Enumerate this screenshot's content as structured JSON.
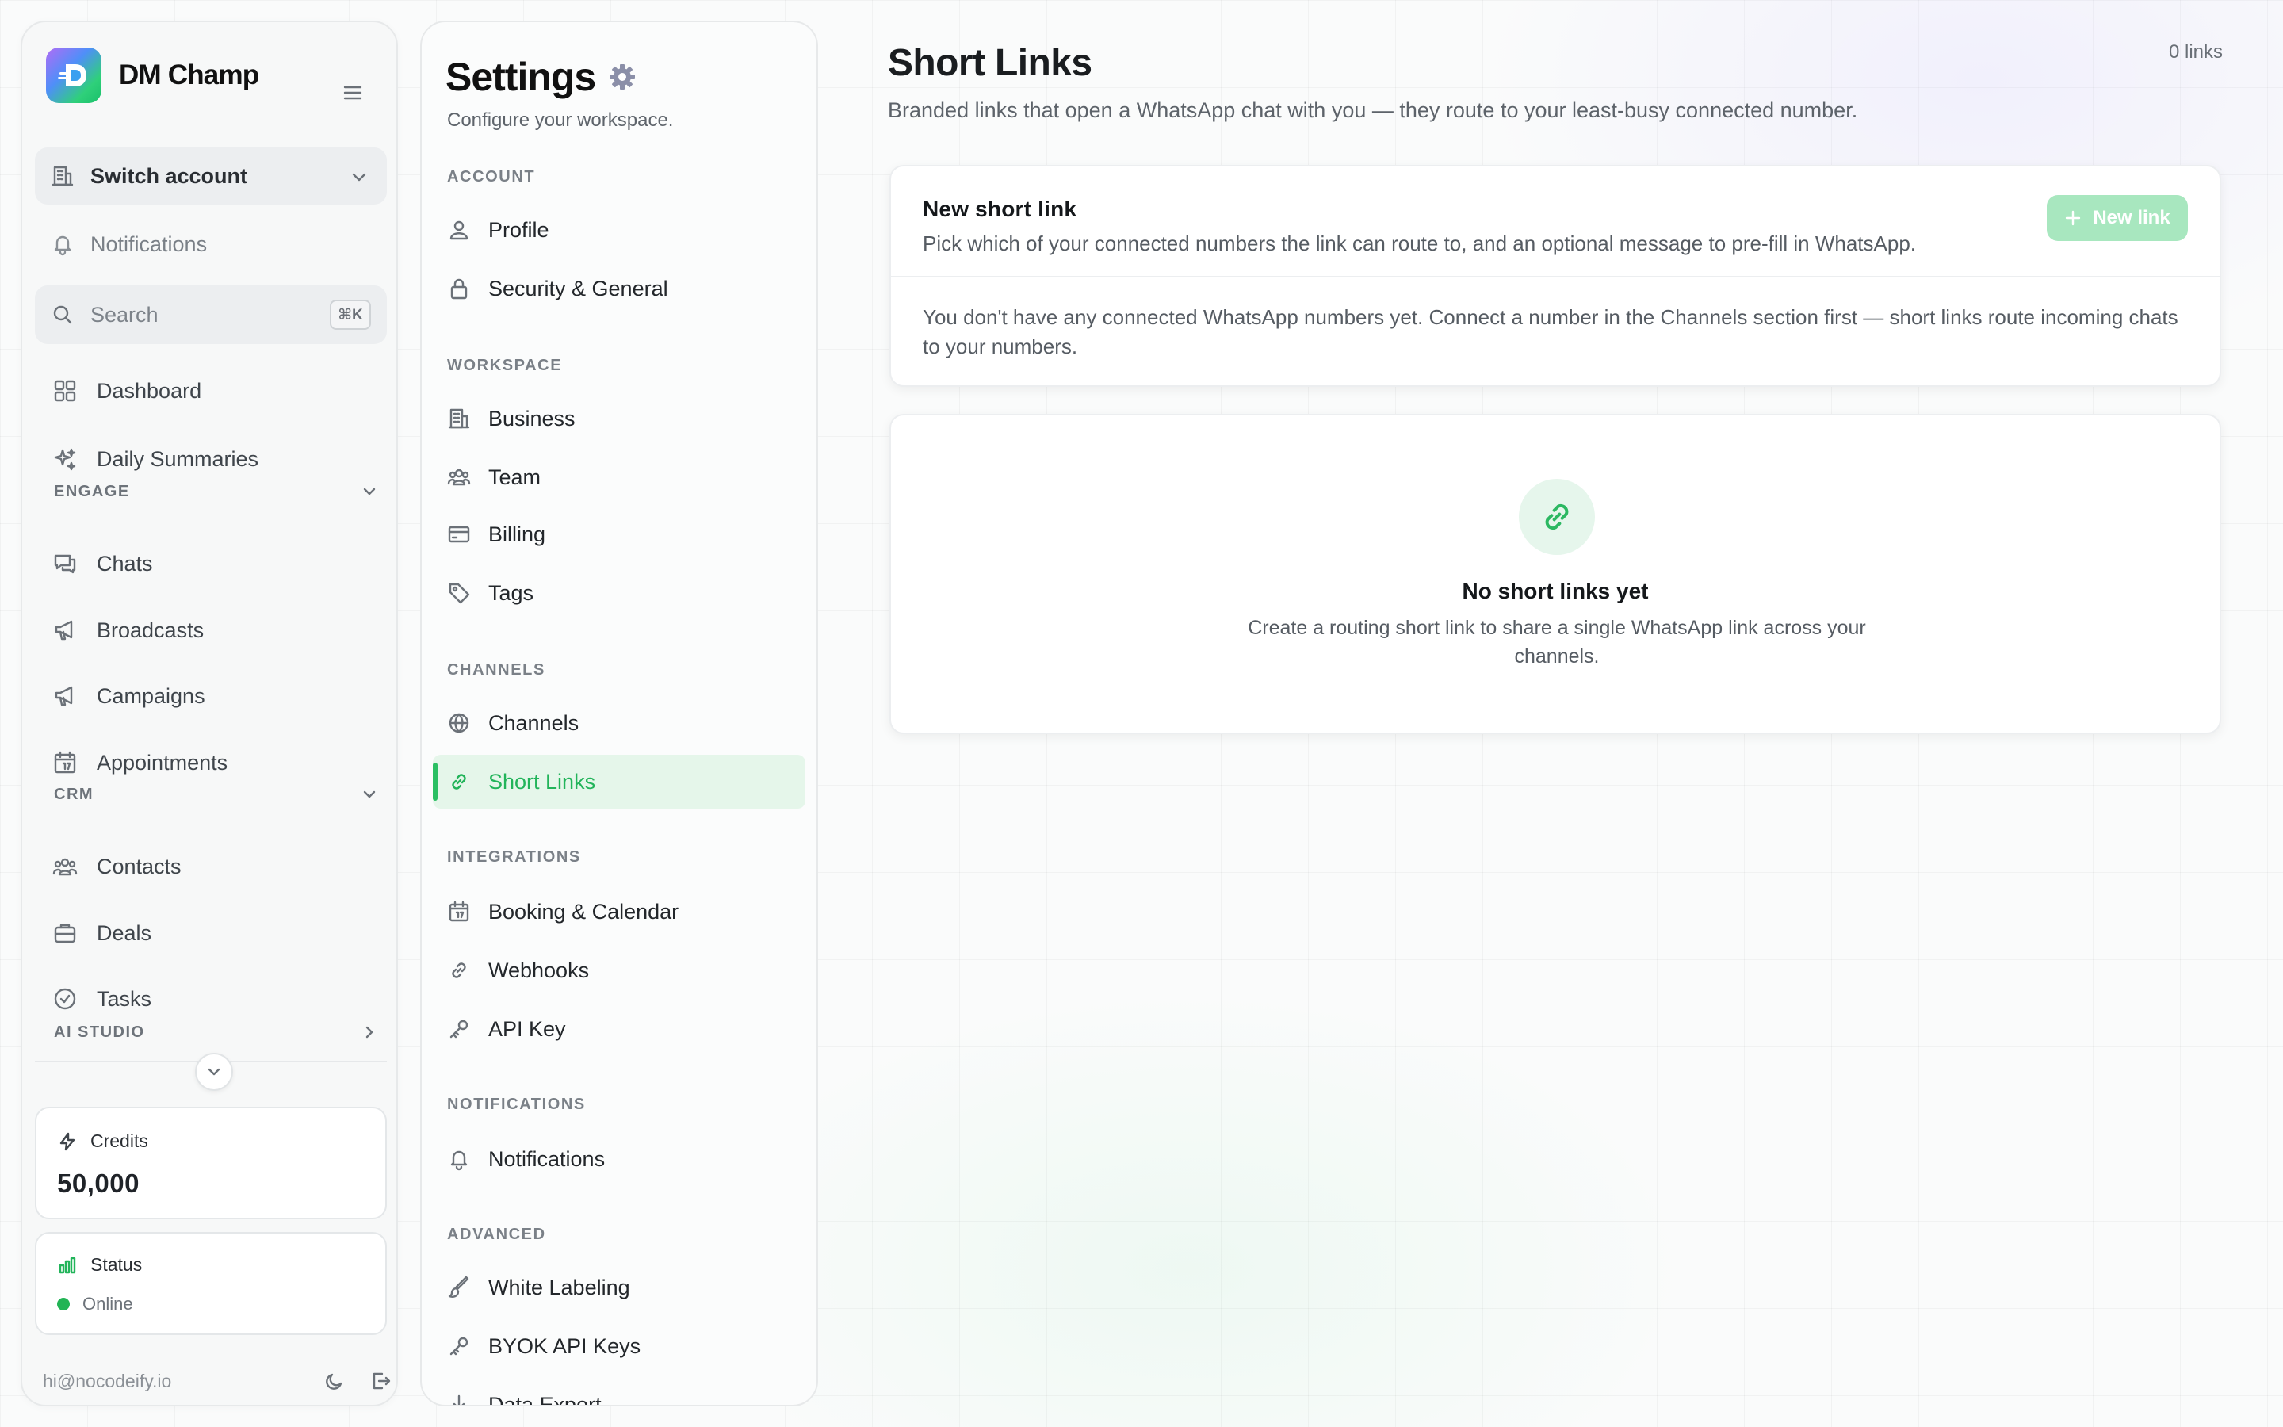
{
  "brand": {
    "name": "DM Champ"
  },
  "sidebar": {
    "switch_account": "Switch account",
    "notifications": "Notifications",
    "search_placeholder": "Search",
    "search_shortcut": "⌘K",
    "items": [
      {
        "label": "Dashboard",
        "icon": "grid-icon"
      },
      {
        "label": "Daily Summaries",
        "icon": "sparkles-icon"
      }
    ],
    "sections": {
      "engage": {
        "label": "ENGAGE",
        "items": [
          {
            "label": "Chats",
            "icon": "chat-icon"
          },
          {
            "label": "Broadcasts",
            "icon": "megaphone-icon"
          },
          {
            "label": "Campaigns",
            "icon": "megaphone-icon"
          },
          {
            "label": "Appointments",
            "icon": "calendar-icon"
          }
        ]
      },
      "crm": {
        "label": "CRM",
        "items": [
          {
            "label": "Contacts",
            "icon": "users-icon"
          },
          {
            "label": "Deals",
            "icon": "briefcase-icon"
          },
          {
            "label": "Tasks",
            "icon": "check-circle-icon"
          }
        ]
      },
      "ai_studio": {
        "label": "AI STUDIO"
      }
    },
    "credits": {
      "label": "Credits",
      "value": "50,000"
    },
    "status": {
      "label": "Status",
      "value": "Online"
    },
    "email": "hi@nocodeify.io"
  },
  "settings": {
    "title": "Settings",
    "subtitle": "Configure your workspace.",
    "sections": [
      {
        "label": "ACCOUNT",
        "items": [
          "Profile",
          "Security & General"
        ]
      },
      {
        "label": "WORKSPACE",
        "items": [
          "Business",
          "Team",
          "Billing",
          "Tags"
        ]
      },
      {
        "label": "CHANNELS",
        "items": [
          "Channels",
          "Short Links"
        ]
      },
      {
        "label": "INTEGRATIONS",
        "items": [
          "Booking & Calendar",
          "Webhooks",
          "API Key"
        ]
      },
      {
        "label": "NOTIFICATIONS",
        "items": [
          "Notifications"
        ]
      },
      {
        "label": "ADVANCED",
        "items": [
          "White Labeling",
          "BYOK API Keys",
          "Data Export"
        ]
      }
    ],
    "active": "Short Links"
  },
  "main": {
    "title": "Short Links",
    "subtitle": "Branded links that open a WhatsApp chat with you — they route to your least-busy connected number.",
    "count": "0 links",
    "new_card": {
      "title": "New short link",
      "description": "Pick which of your connected numbers the link can route to, and an optional message to pre-fill in WhatsApp.",
      "button": "New link",
      "message": "You don't have any connected WhatsApp numbers yet. Connect a number in the Channels section first — short links route incoming chats to your numbers."
    },
    "empty": {
      "title": "No short links yet",
      "description": "Create a routing short link to share a single WhatsApp link across your channels."
    }
  },
  "colors": {
    "accent": "#22b45a",
    "accent_bg": "#e5f6ea",
    "online": "#22b455"
  }
}
